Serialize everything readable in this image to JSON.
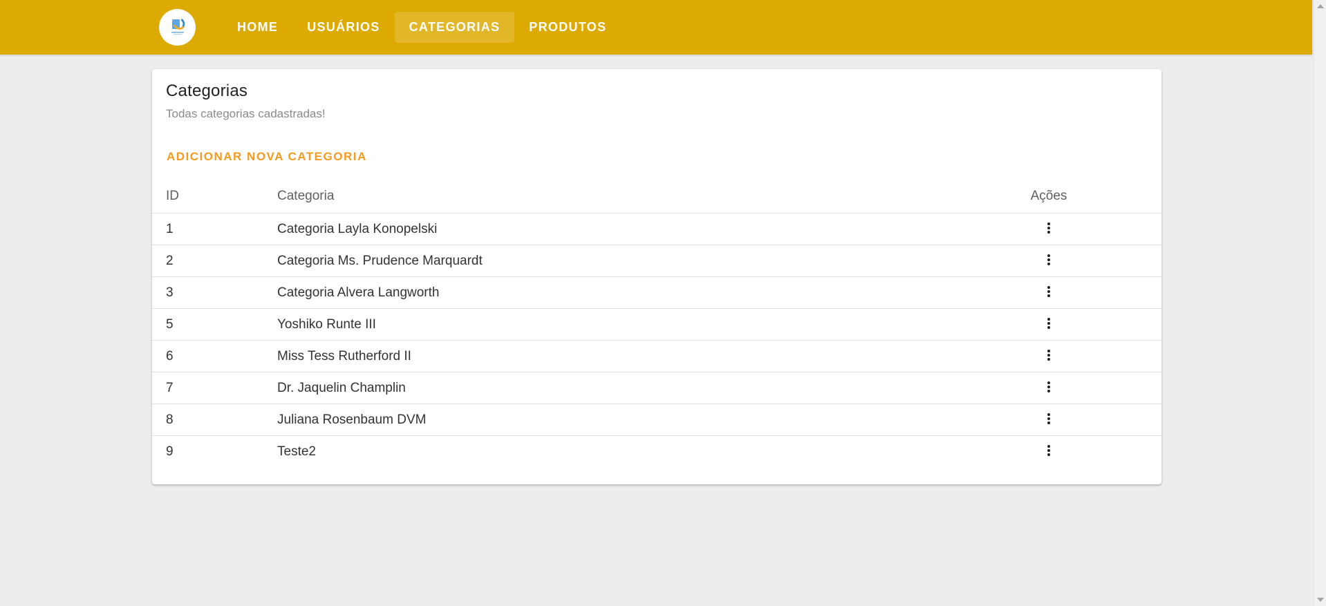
{
  "header": {
    "logo_icon": "company-logo",
    "nav": [
      {
        "label": "HOME",
        "active": false
      },
      {
        "label": "USUÁRIOS",
        "active": false
      },
      {
        "label": "CATEGORIAS",
        "active": true
      },
      {
        "label": "PRODUTOS",
        "active": false
      }
    ]
  },
  "card": {
    "title": "Categorias",
    "subtitle": "Todas categorias cadastradas!",
    "add_button": "ADICIONAR NOVA CATEGORIA"
  },
  "table": {
    "headers": {
      "id": "ID",
      "name": "Categoria",
      "actions": "Ações"
    },
    "actions_icon": "more-vertical-icon",
    "rows": [
      {
        "id": "1",
        "name": "Categoria Layla Konopelski"
      },
      {
        "id": "2",
        "name": "Categoria Ms. Prudence Marquardt"
      },
      {
        "id": "3",
        "name": "Categoria Alvera Langworth"
      },
      {
        "id": "5",
        "name": "Yoshiko Runte III"
      },
      {
        "id": "6",
        "name": "Miss Tess Rutherford II"
      },
      {
        "id": "7",
        "name": "Dr. Jaquelin Champlin"
      },
      {
        "id": "8",
        "name": "Juliana Rosenbaum DVM"
      },
      {
        "id": "9",
        "name": "Teste2"
      }
    ]
  },
  "colors": {
    "app_bar": "#dcaa00",
    "accent": "#f59a1d",
    "background": "#ededed"
  }
}
